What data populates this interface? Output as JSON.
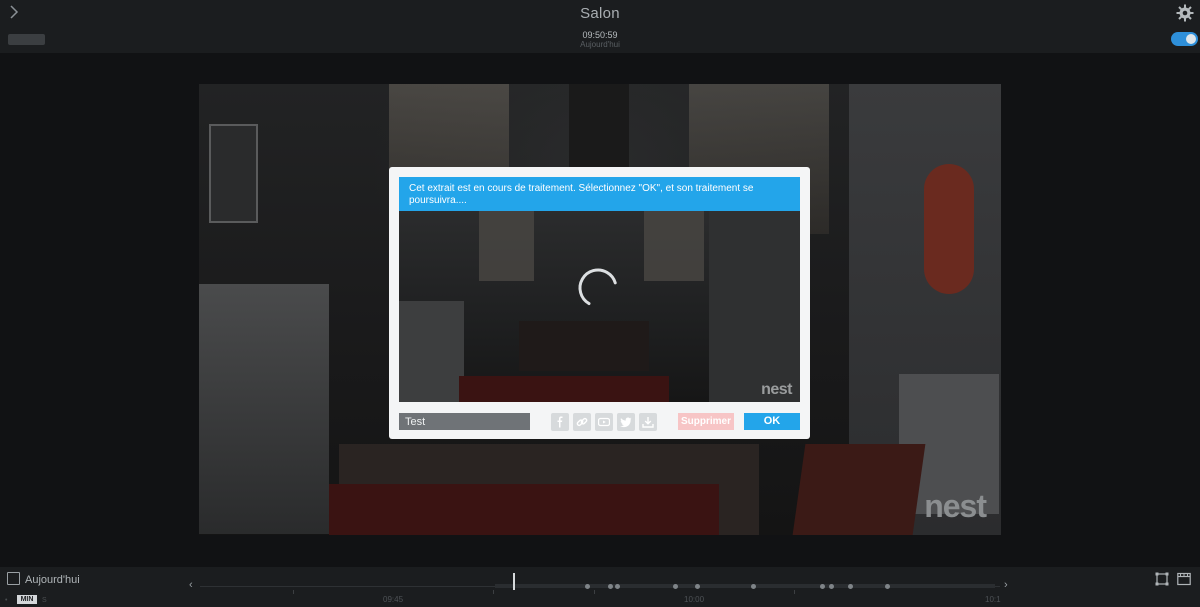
{
  "header": {
    "title": "Salon",
    "time": "09:50:59",
    "date_label": "Aujourd'hui",
    "toggle_on": true
  },
  "video": {
    "watermark": "nest"
  },
  "dialog": {
    "message": "Cet extrait est en cours de traitement. Sélectionnez \"OK\", et son traitement se poursuivra....",
    "clip_name_value": "Test",
    "preview_watermark": "nest",
    "share_icons": [
      "facebook-icon",
      "link-icon",
      "youtube-icon",
      "twitter-icon",
      "download-icon"
    ],
    "delete_label": "Supprimer",
    "ok_label": "OK"
  },
  "timeline": {
    "today_label": "Aujourd'hui",
    "zoom_label": "MIN",
    "tick_labels": [
      "09:45",
      "10:00",
      "10:1"
    ]
  },
  "colors": {
    "accent": "#23a5ea",
    "delete_button": "#f7c5c6",
    "background": "#111214"
  }
}
